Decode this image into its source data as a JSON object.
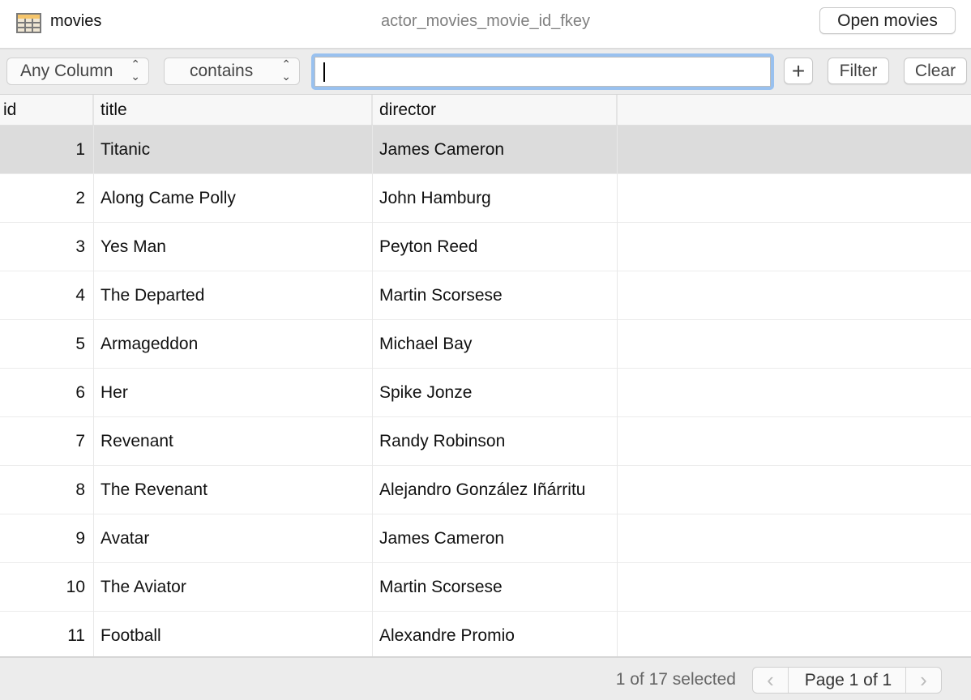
{
  "header": {
    "table_name": "movies",
    "foreign_key": "actor_movies_movie_id_fkey",
    "open_button": "Open movies"
  },
  "filter": {
    "column_select": "Any Column",
    "operator_select": "contains",
    "search_value": "",
    "add_button": "+",
    "filter_button": "Filter",
    "clear_button": "Clear"
  },
  "table": {
    "columns": [
      "id",
      "title",
      "director"
    ],
    "rows": [
      {
        "id": "1",
        "title": "Titanic",
        "director": "James Cameron",
        "selected": true
      },
      {
        "id": "2",
        "title": "Along Came Polly",
        "director": "John Hamburg"
      },
      {
        "id": "3",
        "title": "Yes Man",
        "director": "Peyton Reed"
      },
      {
        "id": "4",
        "title": "The Departed",
        "director": "Martin Scorsese"
      },
      {
        "id": "5",
        "title": "Armageddon",
        "director": "Michael Bay"
      },
      {
        "id": "6",
        "title": "Her",
        "director": "Spike Jonze"
      },
      {
        "id": "7",
        "title": "Revenant",
        "director": "Randy Robinson"
      },
      {
        "id": "8",
        "title": "The Revenant",
        "director": "Alejandro González Iñárritu"
      },
      {
        "id": "9",
        "title": "Avatar",
        "director": "James Cameron"
      },
      {
        "id": "10",
        "title": "The Aviator",
        "director": "Martin Scorsese"
      },
      {
        "id": "11",
        "title": "Football",
        "director": "Alexandre Promio"
      }
    ]
  },
  "footer": {
    "selection_status": "1 of 17 selected",
    "page_label": "Page 1 of 1",
    "prev": "‹",
    "next": "›"
  }
}
